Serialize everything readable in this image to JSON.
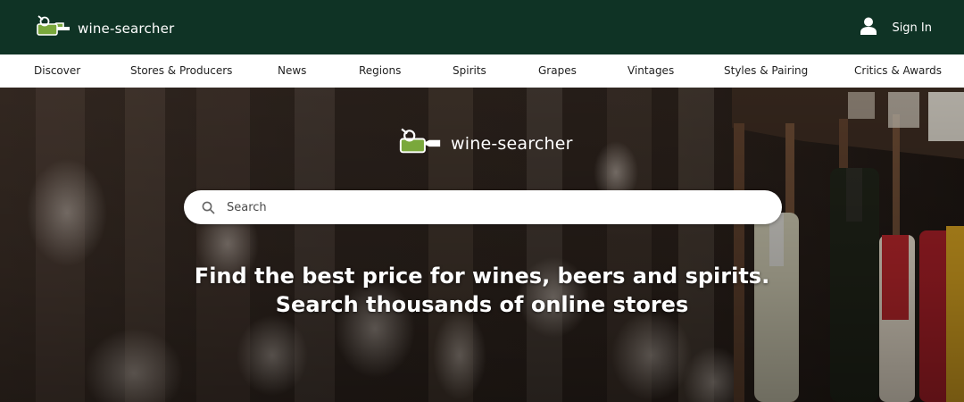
{
  "header": {
    "brand": "wine-searcher",
    "signin_label": "Sign In"
  },
  "nav": {
    "items": [
      {
        "label": "Discover",
        "id": "discover"
      },
      {
        "label": "Stores & Producers",
        "id": "stores-producers"
      },
      {
        "label": "News",
        "id": "news"
      },
      {
        "label": "Regions",
        "id": "regions"
      },
      {
        "label": "Spirits",
        "id": "spirits"
      },
      {
        "label": "Grapes",
        "id": "grapes"
      },
      {
        "label": "Vintages",
        "id": "vintages"
      },
      {
        "label": "Styles & Pairing",
        "id": "styles-pairing"
      },
      {
        "label": "Critics & Awards",
        "id": "critics-awards"
      }
    ]
  },
  "hero": {
    "brand": "wine-searcher",
    "search_placeholder": "Search",
    "tagline_line1": "Find the best price for wines, beers and spirits.",
    "tagline_line2": "Search thousands of online stores"
  },
  "colors": {
    "topbar": "#0f3325",
    "logo_green": "#7aa83c"
  },
  "icons": [
    "wine-bottle-logo-icon",
    "user-icon",
    "search-icon"
  ]
}
